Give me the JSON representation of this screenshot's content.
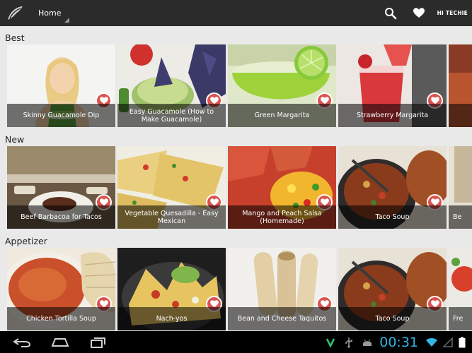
{
  "action_bar": {
    "title": "Home",
    "user_label": "HI TECHIE",
    "icons": [
      "app-logo-icon",
      "search-icon",
      "heart-icon"
    ]
  },
  "sections": [
    {
      "title": "Best",
      "cards": [
        {
          "label": "Skinny Guacamole Dip",
          "image": "woman-with-guacamole"
        },
        {
          "label": "Easy Guacamole (How to Make Guacamole)",
          "image": "guacamole-bowl-chips"
        },
        {
          "label": "Green Margarita",
          "image": "green-margarita-lime"
        },
        {
          "label": "Strawberry Margarita",
          "image": "strawberry-margarita-pour"
        },
        {
          "label": "",
          "image": "partial-card"
        }
      ]
    },
    {
      "title": "New",
      "cards": [
        {
          "label": "Beef Barbacoa for Tacos",
          "image": "barbacoa-plate"
        },
        {
          "label": "Vegetable Quesadilla - Easy Mexican",
          "image": "quesadilla-wedges"
        },
        {
          "label": "Mango and Peach Salsa (Homemade)",
          "image": "mango-salsa"
        },
        {
          "label": "Taco Soup",
          "image": "taco-soup-pot"
        },
        {
          "label": "Be",
          "image": "partial-card"
        }
      ]
    },
    {
      "title": "Appetizer",
      "cards": [
        {
          "label": "Chicken Tortilla Soup",
          "image": "tortilla-soup-bowl"
        },
        {
          "label": "Nach-yos",
          "image": "nachos-plate"
        },
        {
          "label": "Bean and Cheese Taquitos",
          "image": "taquitos"
        },
        {
          "label": "Taco Soup",
          "image": "taco-soup-pot"
        },
        {
          "label": "Fre",
          "image": "partial-card"
        }
      ]
    }
  ],
  "system_bar": {
    "clock": "00:31",
    "nav_icons": [
      "back-icon",
      "home-icon",
      "recent-apps-icon"
    ],
    "status_icons": [
      "vine-notification-icon",
      "usb-icon",
      "android-debug-icon",
      "wifi-icon",
      "signal-icon",
      "battery-icon"
    ]
  },
  "colors": {
    "action_bar": "#2b2b2b",
    "background": "#e9e9e9",
    "favorite": "#d9534f",
    "clock": "#33b5e5"
  }
}
